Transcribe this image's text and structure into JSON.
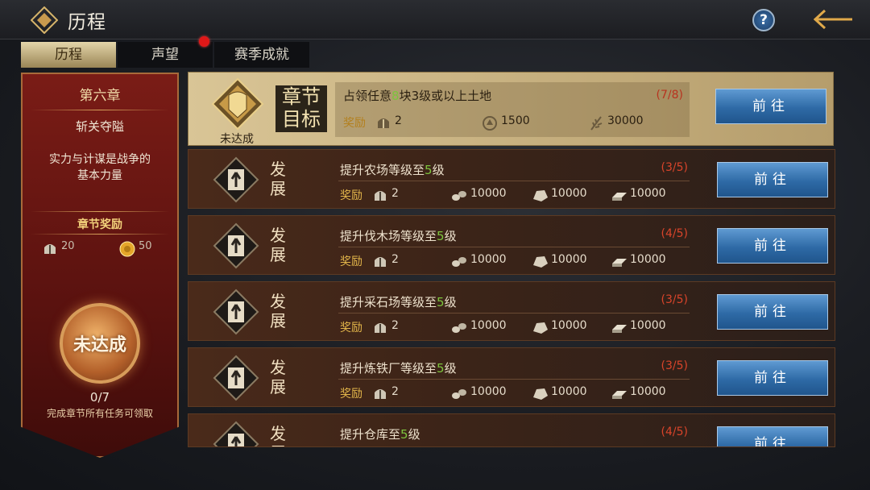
{
  "header": {
    "title": "历程",
    "help_label": "?"
  },
  "tabs": [
    {
      "label": "历程",
      "active": true
    },
    {
      "label": "声望",
      "notification": true
    },
    {
      "label": "赛季成就"
    }
  ],
  "chapter": {
    "name": "第六章",
    "subtitle": "斩关夺隘",
    "description_lines": [
      "实力与计谋是战争的",
      "基本力量"
    ],
    "reward_title": "章节奖励",
    "rewards": [
      {
        "icon": "helmet-icon",
        "value": "20"
      },
      {
        "icon": "gold-coin-icon",
        "value": "50"
      }
    ],
    "status": "未达成",
    "progress": "0/7",
    "hint": "完成章节所有任务可领取"
  },
  "goal": {
    "tag_line1": "章节",
    "tag_line2": "目标",
    "status": "未达成",
    "text_prefix": "占领任意",
    "text_highlight": "8",
    "text_suffix": "块3级或以上土地",
    "count": "(7/8)",
    "reward_label": "奖励",
    "rewards": [
      {
        "icon": "helmet-icon",
        "value": "2"
      },
      {
        "icon": "prestige-icon",
        "value": "1500"
      },
      {
        "icon": "wheat-icon",
        "value": "30000"
      }
    ],
    "button": "前往"
  },
  "tasks": [
    {
      "tag_line1": "发",
      "tag_line2": "展",
      "title_prefix": "提升农场等级至",
      "title_highlight": "5",
      "title_suffix": "级",
      "count": "(3/5)",
      "reward_label": "奖励",
      "rewards": [
        {
          "icon": "helmet-icon",
          "value": "2"
        },
        {
          "icon": "wood-icon",
          "value": "10000"
        },
        {
          "icon": "stone-icon",
          "value": "10000"
        },
        {
          "icon": "iron-icon",
          "value": "10000"
        }
      ],
      "button": "前往"
    },
    {
      "tag_line1": "发",
      "tag_line2": "展",
      "title_prefix": "提升伐木场等级至",
      "title_highlight": "5",
      "title_suffix": "级",
      "count": "(4/5)",
      "reward_label": "奖励",
      "rewards": [
        {
          "icon": "helmet-icon",
          "value": "2"
        },
        {
          "icon": "wood-icon",
          "value": "10000"
        },
        {
          "icon": "stone-icon",
          "value": "10000"
        },
        {
          "icon": "iron-icon",
          "value": "10000"
        }
      ],
      "button": "前往"
    },
    {
      "tag_line1": "发",
      "tag_line2": "展",
      "title_prefix": "提升采石场等级至",
      "title_highlight": "5",
      "title_suffix": "级",
      "count": "(3/5)",
      "reward_label": "奖励",
      "rewards": [
        {
          "icon": "helmet-icon",
          "value": "2"
        },
        {
          "icon": "wood-icon",
          "value": "10000"
        },
        {
          "icon": "stone-icon",
          "value": "10000"
        },
        {
          "icon": "iron-icon",
          "value": "10000"
        }
      ],
      "button": "前往"
    },
    {
      "tag_line1": "发",
      "tag_line2": "展",
      "title_prefix": "提升炼铁厂等级至",
      "title_highlight": "5",
      "title_suffix": "级",
      "count": "(3/5)",
      "reward_label": "奖励",
      "rewards": [
        {
          "icon": "helmet-icon",
          "value": "2"
        },
        {
          "icon": "wood-icon",
          "value": "10000"
        },
        {
          "icon": "stone-icon",
          "value": "10000"
        },
        {
          "icon": "iron-icon",
          "value": "10000"
        }
      ],
      "button": "前往"
    },
    {
      "tag_line1": "发",
      "tag_line2": "展",
      "title_prefix": "提升仓库至",
      "title_highlight": "5",
      "title_suffix": "级",
      "count": "(4/5)",
      "button": "前往"
    }
  ],
  "colors": {
    "accent_gold": "#e2b54a",
    "count_red": "#d9442a",
    "highlight_green": "#7dc33d",
    "button_blue": "#2e6aa6"
  }
}
